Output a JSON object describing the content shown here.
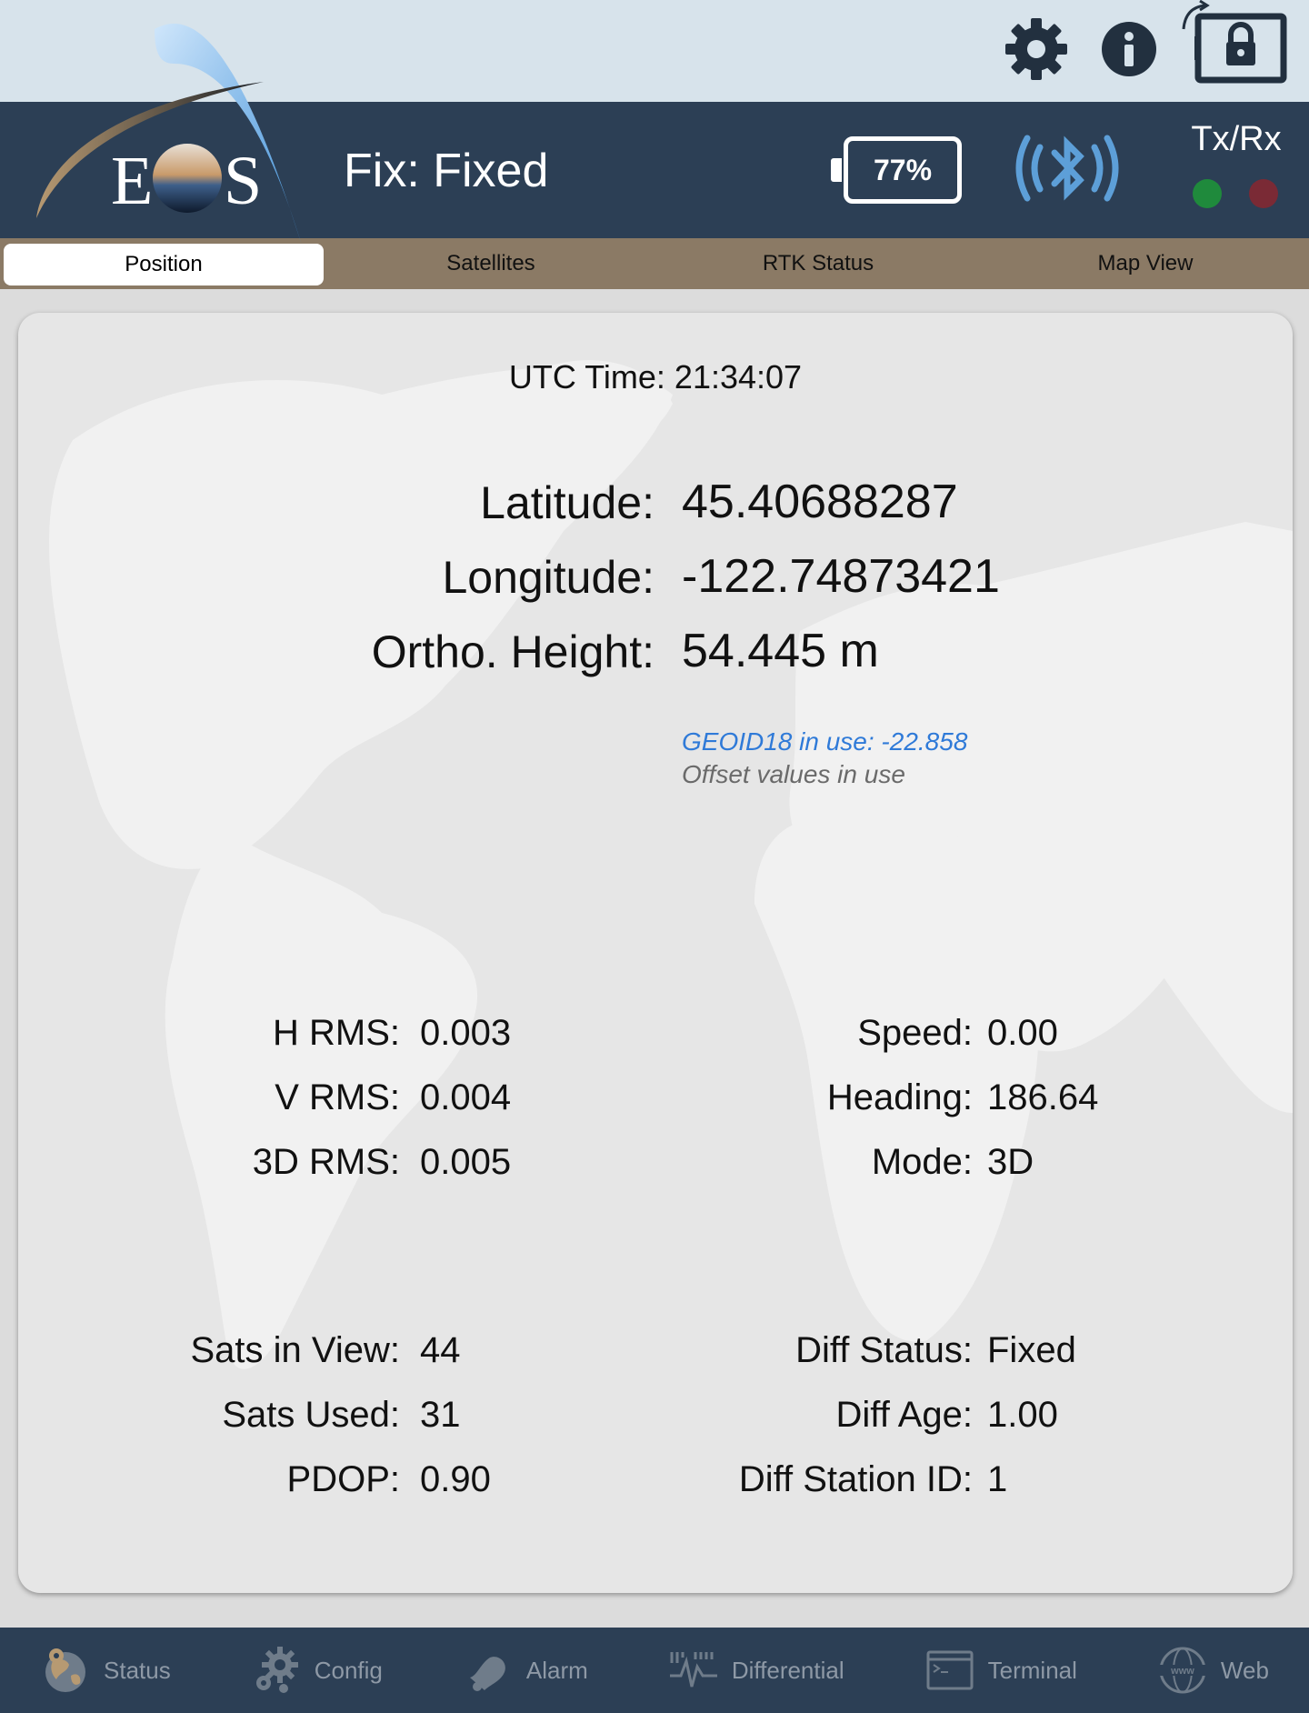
{
  "header": {
    "logo_text": "EOS",
    "fix_text": "Fix: Fixed",
    "battery": "77%",
    "txrx_label": "Tx/Rx"
  },
  "tabs": [
    {
      "label": "Position",
      "active": true
    },
    {
      "label": "Satellites",
      "active": false
    },
    {
      "label": "RTK Status",
      "active": false
    },
    {
      "label": "Map View",
      "active": false
    }
  ],
  "position": {
    "utc": "UTC Time: 21:34:07",
    "latitude_label": "Latitude:",
    "latitude": "45.40688287",
    "longitude_label": "Longitude:",
    "longitude": "-122.74873421",
    "height_label": "Ortho. Height:",
    "height": "54.445 m",
    "geoid": "GEOID18 in use: -22.858",
    "offset": "Offset values in use"
  },
  "stats_left_1": [
    {
      "label": "H RMS:",
      "value": "0.003"
    },
    {
      "label": "V RMS:",
      "value": "0.004"
    },
    {
      "label": "3D RMS:",
      "value": "0.005"
    }
  ],
  "stats_right_1": [
    {
      "label": "Speed:",
      "value": "0.00"
    },
    {
      "label": "Heading:",
      "value": "186.64"
    },
    {
      "label": "Mode:",
      "value": "3D"
    }
  ],
  "stats_left_2": [
    {
      "label": "Sats in View:",
      "value": "44"
    },
    {
      "label": "Sats Used:",
      "value": "31"
    },
    {
      "label": "PDOP:",
      "value": "0.90"
    }
  ],
  "stats_right_2": [
    {
      "label": "Diff Status:",
      "value": "Fixed"
    },
    {
      "label": "Diff Age:",
      "value": "1.00"
    },
    {
      "label": "Diff Station ID:",
      "value": "1"
    }
  ],
  "bottom_nav": [
    {
      "label": "Status",
      "icon": "globe-icon"
    },
    {
      "label": "Config",
      "icon": "gears-icon"
    },
    {
      "label": "Alarm",
      "icon": "bell-icon"
    },
    {
      "label": "Differential",
      "icon": "signal-icon"
    },
    {
      "label": "Terminal",
      "icon": "terminal-icon"
    },
    {
      "label": "Web",
      "icon": "www-icon"
    }
  ],
  "colors": {
    "header_bg": "#2c3f55",
    "tab_bar_bg": "#8b7a65",
    "top_bar_bg": "#d7e3eb",
    "geoid_text": "#2f7ad8",
    "tx_led": "#1f8a3c",
    "rx_led": "#7a2a35"
  }
}
